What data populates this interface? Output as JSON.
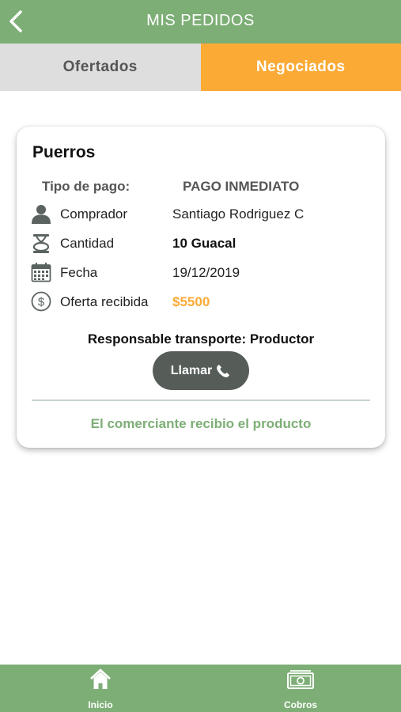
{
  "header": {
    "title": "MIS PEDIDOS"
  },
  "tabs": [
    {
      "label": "Ofertados",
      "active": false
    },
    {
      "label": "Negociados",
      "active": true
    }
  ],
  "card": {
    "product": "Puerros",
    "payment": {
      "label": "Tipo de pago:",
      "value": "PAGO INMEDIATO"
    },
    "rows": [
      {
        "icon": "person-icon",
        "label": "Comprador",
        "value": "Santiago Rodriguez C"
      },
      {
        "icon": "scale-icon",
        "label": "Cantidad",
        "value": "10 Guacal"
      },
      {
        "icon": "calendar-icon",
        "label": "Fecha",
        "value": "19/12/2019"
      },
      {
        "icon": "dollar-icon",
        "label": "Oferta recibida",
        "value": "$5500"
      }
    ],
    "transport": "Responsable transporte: Productor",
    "call_label": "Llamar",
    "status": "El comerciante recibio el producto"
  },
  "bottom_nav": [
    {
      "icon": "home-icon",
      "label": "Inicio"
    },
    {
      "icon": "money-icon",
      "label": "Cobros"
    }
  ],
  "colors": {
    "primary_green": "#7dae76",
    "accent_orange": "#fbaa36",
    "tab_inactive": "#dedede",
    "button_dark": "#565d59"
  }
}
